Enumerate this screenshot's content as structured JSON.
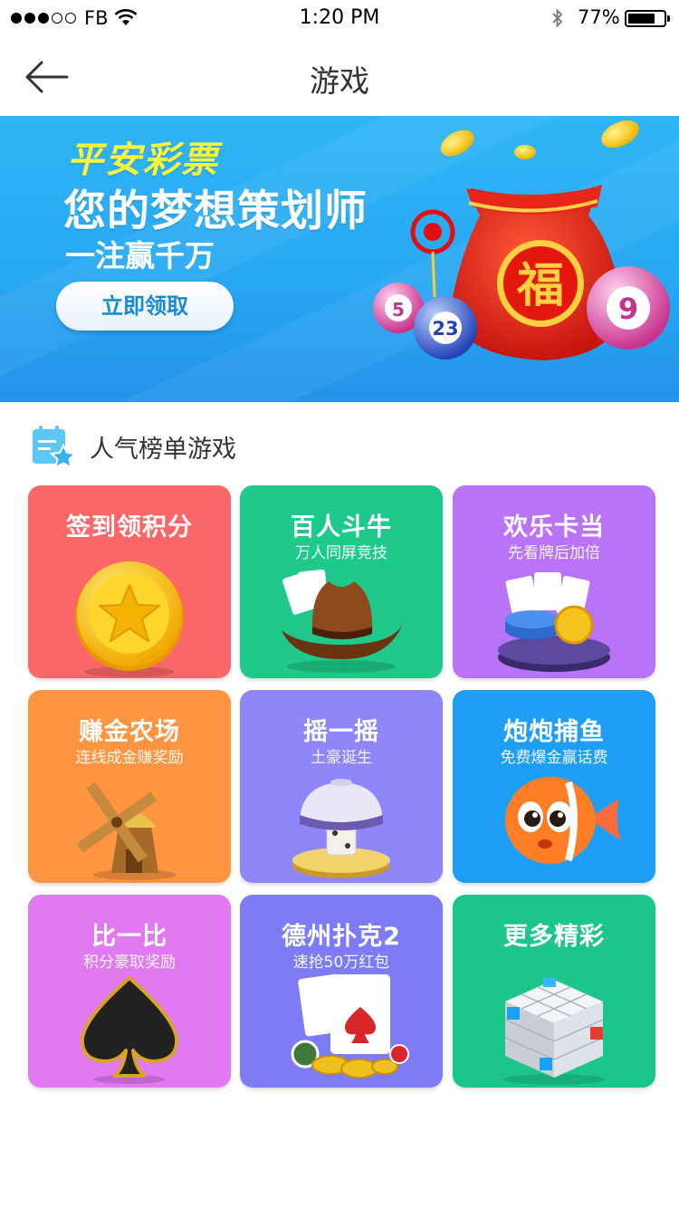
{
  "status_bar": {
    "carrier": "FB",
    "time": "1:20 PM",
    "battery_percent": "77%",
    "battery_level": 0.77,
    "signal_bars_filled": 3,
    "signal_bars_total": 5
  },
  "nav": {
    "title": "游戏"
  },
  "banner": {
    "brand": "平安彩票",
    "headline": "您的梦想策划师",
    "subline": "一注赢千万",
    "button_label": "立即领取",
    "lottery_balls": [
      "5",
      "23",
      "9"
    ],
    "bag_character": "福"
  },
  "section": {
    "title": "人气榜单游戏"
  },
  "games": [
    {
      "title": "签到领积分",
      "subtitle": "",
      "color": "#f96769",
      "icon": "star-coin-icon"
    },
    {
      "title": "百人斗牛",
      "subtitle": "万人同屏竞技",
      "color": "#1fc98c",
      "icon": "cowboy-hat-icon"
    },
    {
      "title": "欢乐卡当",
      "subtitle": "先看牌后加倍",
      "color": "#b873f7",
      "icon": "poker-chips-icon"
    },
    {
      "title": "赚金农场",
      "subtitle": "连线成金赚奖励",
      "color": "#ff9540",
      "icon": "windmill-icon"
    },
    {
      "title": "摇一摇",
      "subtitle": "土豪诞生",
      "color": "#8f86f9",
      "icon": "dice-cup-icon"
    },
    {
      "title": "炮炮捕鱼",
      "subtitle": "免费爆金赢话费",
      "color": "#1e9ef5",
      "icon": "fish-icon"
    },
    {
      "title": "比一比",
      "subtitle": "积分豪取奖励",
      "color": "#e17af2",
      "icon": "spade-icon"
    },
    {
      "title": "德州扑克2",
      "subtitle": "速抢50万红包",
      "color": "#7d7cf6",
      "icon": "playing-cards-icon"
    },
    {
      "title": "更多精彩",
      "subtitle": "",
      "color": "#1cc68a",
      "icon": "cube-icon"
    }
  ]
}
